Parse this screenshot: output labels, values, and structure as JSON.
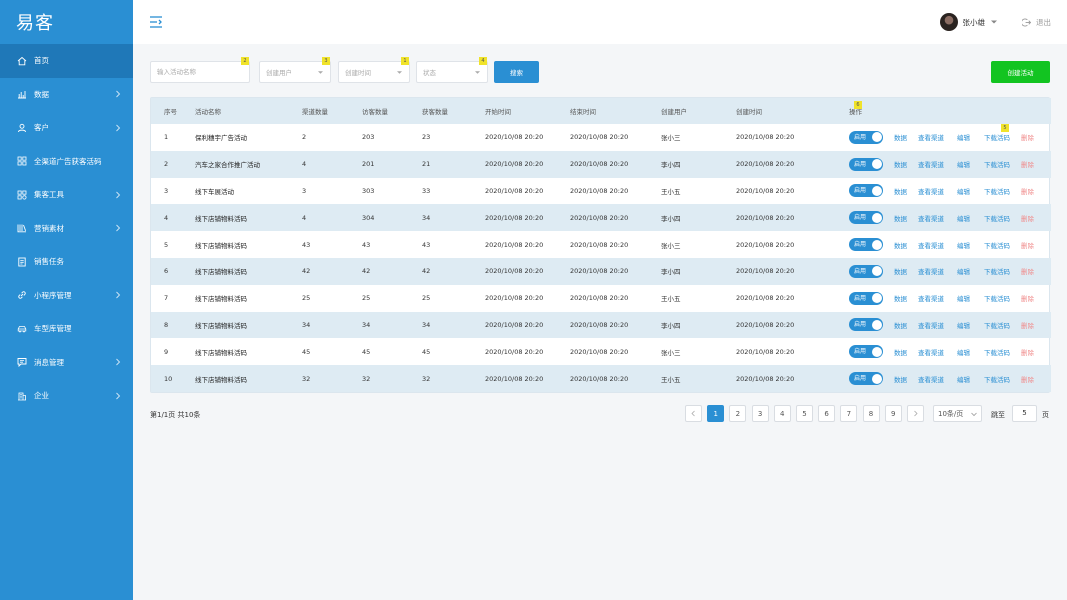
{
  "app": {
    "logo": "易客"
  },
  "sidebar": {
    "items": [
      {
        "label": "首页",
        "icon": "home-icon",
        "arrow": false
      },
      {
        "label": "数据",
        "icon": "chart-icon",
        "arrow": true
      },
      {
        "label": "客户",
        "icon": "user-icon",
        "arrow": true
      },
      {
        "label": "全渠道广告获客活码",
        "icon": "grid-icon",
        "arrow": false
      },
      {
        "label": "集客工具",
        "icon": "apps-icon",
        "arrow": true
      },
      {
        "label": "营销素材",
        "icon": "library-icon",
        "arrow": true
      },
      {
        "label": "销售任务",
        "icon": "task-icon",
        "arrow": false
      },
      {
        "label": "小程序管理",
        "icon": "link-icon",
        "arrow": true
      },
      {
        "label": "车型库管理",
        "icon": "car-icon",
        "arrow": false
      },
      {
        "label": "消息管理",
        "icon": "message-icon",
        "arrow": true
      },
      {
        "label": "企业",
        "icon": "building-icon",
        "arrow": true
      }
    ]
  },
  "header": {
    "user_name": "张小雄",
    "logout": "退出"
  },
  "filters": {
    "name_placeholder": "输入活动名称",
    "creator_placeholder": "创建用户",
    "time_placeholder": "创建时间",
    "status_placeholder": "状态",
    "badges": [
      "2",
      "3",
      "1",
      "4"
    ],
    "search_label": "搜索",
    "create_label": "创建活动"
  },
  "table": {
    "headers": [
      "序号",
      "活动名称",
      "渠道数量",
      "访客数量",
      "获客数量",
      "开始时间",
      "结束时间",
      "创建用户",
      "创建时间",
      "操作"
    ],
    "op_header_badge": "6",
    "download_badge": "5",
    "ops": {
      "toggle": "启用",
      "data": "数据",
      "channel": "查看渠道",
      "edit": "编辑",
      "download": "下载活码",
      "delete": "删除"
    },
    "rows": [
      {
        "no": "1",
        "name": "保利穗宇广告活动",
        "channels": "2",
        "visitors": "203",
        "acquired": "23",
        "start": "2020/10/08 20:20",
        "end": "2020/10/08 20:20",
        "creator": "张小三",
        "created": "2020/10/08 20:20"
      },
      {
        "no": "2",
        "name": "汽车之家合作推广活动",
        "channels": "4",
        "visitors": "201",
        "acquired": "21",
        "start": "2020/10/08 20:20",
        "end": "2020/10/08 20:20",
        "creator": "李小四",
        "created": "2020/10/08 20:20"
      },
      {
        "no": "3",
        "name": "线下车展活动",
        "channels": "3",
        "visitors": "303",
        "acquired": "33",
        "start": "2020/10/08 20:20",
        "end": "2020/10/08 20:20",
        "creator": "王小五",
        "created": "2020/10/08 20:20"
      },
      {
        "no": "4",
        "name": "线下店铺物料活码",
        "channels": "4",
        "visitors": "304",
        "acquired": "34",
        "start": "2020/10/08 20:20",
        "end": "2020/10/08 20:20",
        "creator": "李小四",
        "created": "2020/10/08 20:20"
      },
      {
        "no": "5",
        "name": "线下店铺物料活码",
        "channels": "43",
        "visitors": "43",
        "acquired": "43",
        "start": "2020/10/08 20:20",
        "end": "2020/10/08 20:20",
        "creator": "张小三",
        "created": "2020/10/08 20:20"
      },
      {
        "no": "6",
        "name": "线下店铺物料活码",
        "channels": "42",
        "visitors": "42",
        "acquired": "42",
        "start": "2020/10/08 20:20",
        "end": "2020/10/08 20:20",
        "creator": "李小四",
        "created": "2020/10/08 20:20"
      },
      {
        "no": "7",
        "name": "线下店铺物料活码",
        "channels": "25",
        "visitors": "25",
        "acquired": "25",
        "start": "2020/10/08 20:20",
        "end": "2020/10/08 20:20",
        "creator": "王小五",
        "created": "2020/10/08 20:20"
      },
      {
        "no": "8",
        "name": "线下店铺物料活码",
        "channels": "34",
        "visitors": "34",
        "acquired": "34",
        "start": "2020/10/08 20:20",
        "end": "2020/10/08 20:20",
        "creator": "李小四",
        "created": "2020/10/08 20:20"
      },
      {
        "no": "9",
        "name": "线下店铺物料活码",
        "channels": "45",
        "visitors": "45",
        "acquired": "45",
        "start": "2020/10/08 20:20",
        "end": "2020/10/08 20:20",
        "creator": "张小三",
        "created": "2020/10/08 20:20"
      },
      {
        "no": "10",
        "name": "线下店铺物料活码",
        "channels": "32",
        "visitors": "32",
        "acquired": "32",
        "start": "2020/10/08 20:20",
        "end": "2020/10/08 20:20",
        "creator": "王小五",
        "created": "2020/10/08 20:20"
      }
    ]
  },
  "pagination": {
    "info": "第1/1页  共10条",
    "pages": [
      "1",
      "2",
      "3",
      "4",
      "5",
      "6",
      "7",
      "8",
      "9"
    ],
    "current": "1",
    "page_size": "10条/页",
    "jump_label": "跳至",
    "jump_value": "5",
    "suffix": "页"
  },
  "colors": {
    "primary": "#2a8fd3",
    "sidebar_active": "#1f78b8",
    "create": "#12c421",
    "delete": "#f08a8a"
  }
}
